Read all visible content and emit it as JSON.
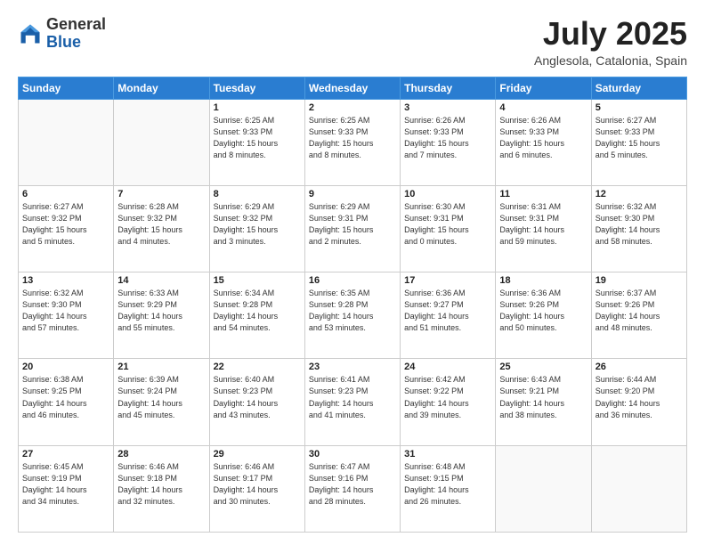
{
  "logo": {
    "general": "General",
    "blue": "Blue"
  },
  "header": {
    "month": "July 2025",
    "location": "Anglesola, Catalonia, Spain"
  },
  "weekdays": [
    "Sunday",
    "Monday",
    "Tuesday",
    "Wednesday",
    "Thursday",
    "Friday",
    "Saturday"
  ],
  "weeks": [
    [
      {
        "day": "",
        "info": ""
      },
      {
        "day": "",
        "info": ""
      },
      {
        "day": "1",
        "info": "Sunrise: 6:25 AM\nSunset: 9:33 PM\nDaylight: 15 hours\nand 8 minutes."
      },
      {
        "day": "2",
        "info": "Sunrise: 6:25 AM\nSunset: 9:33 PM\nDaylight: 15 hours\nand 8 minutes."
      },
      {
        "day": "3",
        "info": "Sunrise: 6:26 AM\nSunset: 9:33 PM\nDaylight: 15 hours\nand 7 minutes."
      },
      {
        "day": "4",
        "info": "Sunrise: 6:26 AM\nSunset: 9:33 PM\nDaylight: 15 hours\nand 6 minutes."
      },
      {
        "day": "5",
        "info": "Sunrise: 6:27 AM\nSunset: 9:33 PM\nDaylight: 15 hours\nand 5 minutes."
      }
    ],
    [
      {
        "day": "6",
        "info": "Sunrise: 6:27 AM\nSunset: 9:32 PM\nDaylight: 15 hours\nand 5 minutes."
      },
      {
        "day": "7",
        "info": "Sunrise: 6:28 AM\nSunset: 9:32 PM\nDaylight: 15 hours\nand 4 minutes."
      },
      {
        "day": "8",
        "info": "Sunrise: 6:29 AM\nSunset: 9:32 PM\nDaylight: 15 hours\nand 3 minutes."
      },
      {
        "day": "9",
        "info": "Sunrise: 6:29 AM\nSunset: 9:31 PM\nDaylight: 15 hours\nand 2 minutes."
      },
      {
        "day": "10",
        "info": "Sunrise: 6:30 AM\nSunset: 9:31 PM\nDaylight: 15 hours\nand 0 minutes."
      },
      {
        "day": "11",
        "info": "Sunrise: 6:31 AM\nSunset: 9:31 PM\nDaylight: 14 hours\nand 59 minutes."
      },
      {
        "day": "12",
        "info": "Sunrise: 6:32 AM\nSunset: 9:30 PM\nDaylight: 14 hours\nand 58 minutes."
      }
    ],
    [
      {
        "day": "13",
        "info": "Sunrise: 6:32 AM\nSunset: 9:30 PM\nDaylight: 14 hours\nand 57 minutes."
      },
      {
        "day": "14",
        "info": "Sunrise: 6:33 AM\nSunset: 9:29 PM\nDaylight: 14 hours\nand 55 minutes."
      },
      {
        "day": "15",
        "info": "Sunrise: 6:34 AM\nSunset: 9:28 PM\nDaylight: 14 hours\nand 54 minutes."
      },
      {
        "day": "16",
        "info": "Sunrise: 6:35 AM\nSunset: 9:28 PM\nDaylight: 14 hours\nand 53 minutes."
      },
      {
        "day": "17",
        "info": "Sunrise: 6:36 AM\nSunset: 9:27 PM\nDaylight: 14 hours\nand 51 minutes."
      },
      {
        "day": "18",
        "info": "Sunrise: 6:36 AM\nSunset: 9:26 PM\nDaylight: 14 hours\nand 50 minutes."
      },
      {
        "day": "19",
        "info": "Sunrise: 6:37 AM\nSunset: 9:26 PM\nDaylight: 14 hours\nand 48 minutes."
      }
    ],
    [
      {
        "day": "20",
        "info": "Sunrise: 6:38 AM\nSunset: 9:25 PM\nDaylight: 14 hours\nand 46 minutes."
      },
      {
        "day": "21",
        "info": "Sunrise: 6:39 AM\nSunset: 9:24 PM\nDaylight: 14 hours\nand 45 minutes."
      },
      {
        "day": "22",
        "info": "Sunrise: 6:40 AM\nSunset: 9:23 PM\nDaylight: 14 hours\nand 43 minutes."
      },
      {
        "day": "23",
        "info": "Sunrise: 6:41 AM\nSunset: 9:23 PM\nDaylight: 14 hours\nand 41 minutes."
      },
      {
        "day": "24",
        "info": "Sunrise: 6:42 AM\nSunset: 9:22 PM\nDaylight: 14 hours\nand 39 minutes."
      },
      {
        "day": "25",
        "info": "Sunrise: 6:43 AM\nSunset: 9:21 PM\nDaylight: 14 hours\nand 38 minutes."
      },
      {
        "day": "26",
        "info": "Sunrise: 6:44 AM\nSunset: 9:20 PM\nDaylight: 14 hours\nand 36 minutes."
      }
    ],
    [
      {
        "day": "27",
        "info": "Sunrise: 6:45 AM\nSunset: 9:19 PM\nDaylight: 14 hours\nand 34 minutes."
      },
      {
        "day": "28",
        "info": "Sunrise: 6:46 AM\nSunset: 9:18 PM\nDaylight: 14 hours\nand 32 minutes."
      },
      {
        "day": "29",
        "info": "Sunrise: 6:46 AM\nSunset: 9:17 PM\nDaylight: 14 hours\nand 30 minutes."
      },
      {
        "day": "30",
        "info": "Sunrise: 6:47 AM\nSunset: 9:16 PM\nDaylight: 14 hours\nand 28 minutes."
      },
      {
        "day": "31",
        "info": "Sunrise: 6:48 AM\nSunset: 9:15 PM\nDaylight: 14 hours\nand 26 minutes."
      },
      {
        "day": "",
        "info": ""
      },
      {
        "day": "",
        "info": ""
      }
    ]
  ]
}
